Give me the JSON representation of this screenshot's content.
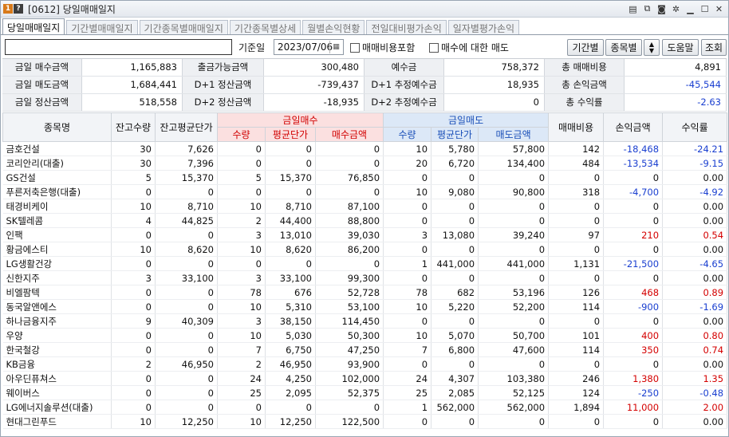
{
  "window": {
    "num_a": "1",
    "num_b": "?",
    "title": "[0612] 당일매매일지"
  },
  "tabs": [
    "당일매매일지",
    "기간별매매일지",
    "기간종목별매매일지",
    "기간종목별상세",
    "월별손익현황",
    "전일대비평가손익",
    "일자별평가손익"
  ],
  "toolbar": {
    "date_label": "기준일",
    "date": "2023/07/06",
    "include_fee": "매매비용포함",
    "sell_label": "매수에 대한 매도",
    "btn_period": "기간별",
    "btn_item": "종목별",
    "btn_help": "도움말",
    "btn_query": "조회"
  },
  "summary": [
    [
      [
        "금일 매수금액",
        "1,165,883"
      ],
      [
        "출금가능금액",
        "300,480"
      ],
      [
        "예수금",
        "758,372"
      ],
      [
        "총 매매비용",
        "4,891"
      ]
    ],
    [
      [
        "금일 매도금액",
        "1,684,441"
      ],
      [
        "D+1 정산금액",
        "-739,437"
      ],
      [
        "D+1 추정예수금",
        "18,935"
      ],
      [
        "총 손익금액",
        "-45,544"
      ]
    ],
    [
      [
        "금일 정산금액",
        "518,558"
      ],
      [
        "D+2 정산금액",
        "-18,935"
      ],
      [
        "D+2 추정예수금",
        "0"
      ],
      [
        "총 수익률",
        "-2.63"
      ]
    ]
  ],
  "header": {
    "name": "종목명",
    "hold_qty": "잔고수량",
    "hold_avg": "잔고평균단가",
    "buy_group": "금일매수",
    "sell_group": "금일매도",
    "qty": "수량",
    "avg": "평균단가",
    "buy_amt": "매수금액",
    "sell_amt": "매도금액",
    "fee": "매매비용",
    "pnl": "손익금액",
    "rate": "수익률"
  },
  "rows": [
    [
      "금호건설",
      "30",
      "7,626",
      "0",
      "0",
      "0",
      "10",
      "5,780",
      "57,800",
      "142",
      "-18,468",
      "-24.21"
    ],
    [
      "코리안리(대출)",
      "30",
      "7,396",
      "0",
      "0",
      "0",
      "20",
      "6,720",
      "134,400",
      "484",
      "-13,534",
      "-9.15"
    ],
    [
      "GS건설",
      "5",
      "15,370",
      "5",
      "15,370",
      "76,850",
      "0",
      "0",
      "0",
      "0",
      "0",
      "0.00"
    ],
    [
      "푸른저축은행(대출)",
      "0",
      "0",
      "0",
      "0",
      "0",
      "10",
      "9,080",
      "90,800",
      "318",
      "-4,700",
      "-4.92"
    ],
    [
      "태경비케이",
      "10",
      "8,710",
      "10",
      "8,710",
      "87,100",
      "0",
      "0",
      "0",
      "0",
      "0",
      "0.00"
    ],
    [
      "SK텔레콤",
      "4",
      "44,825",
      "2",
      "44,400",
      "88,800",
      "0",
      "0",
      "0",
      "0",
      "0",
      "0.00"
    ],
    [
      "인팩",
      "0",
      "0",
      "3",
      "13,010",
      "39,030",
      "3",
      "13,080",
      "39,240",
      "97",
      "210",
      "0.54"
    ],
    [
      "황금에스티",
      "10",
      "8,620",
      "10",
      "8,620",
      "86,200",
      "0",
      "0",
      "0",
      "0",
      "0",
      "0.00"
    ],
    [
      "LG생활건강",
      "0",
      "0",
      "0",
      "0",
      "0",
      "1",
      "441,000",
      "441,000",
      "1,131",
      "-21,500",
      "-4.65"
    ],
    [
      "신한지주",
      "3",
      "33,100",
      "3",
      "33,100",
      "99,300",
      "0",
      "0",
      "0",
      "0",
      "0",
      "0.00"
    ],
    [
      "비엘팜텍",
      "0",
      "0",
      "78",
      "676",
      "52,728",
      "78",
      "682",
      "53,196",
      "126",
      "468",
      "0.89"
    ],
    [
      "동국알앤에스",
      "0",
      "0",
      "10",
      "5,310",
      "53,100",
      "10",
      "5,220",
      "52,200",
      "114",
      "-900",
      "-1.69"
    ],
    [
      "하나금융지주",
      "9",
      "40,309",
      "3",
      "38,150",
      "114,450",
      "0",
      "0",
      "0",
      "0",
      "0",
      "0.00"
    ],
    [
      "우양",
      "0",
      "0",
      "10",
      "5,030",
      "50,300",
      "10",
      "5,070",
      "50,700",
      "101",
      "400",
      "0.80"
    ],
    [
      "한국철강",
      "0",
      "0",
      "7",
      "6,750",
      "47,250",
      "7",
      "6,800",
      "47,600",
      "114",
      "350",
      "0.74"
    ],
    [
      "KB금융",
      "2",
      "46,950",
      "2",
      "46,950",
      "93,900",
      "0",
      "0",
      "0",
      "0",
      "0",
      "0.00"
    ],
    [
      "아우딘퓨쳐스",
      "0",
      "0",
      "24",
      "4,250",
      "102,000",
      "24",
      "4,307",
      "103,380",
      "246",
      "1,380",
      "1.35"
    ],
    [
      "웨이버스",
      "0",
      "0",
      "25",
      "2,095",
      "52,375",
      "25",
      "2,085",
      "52,125",
      "124",
      "-250",
      "-0.48"
    ],
    [
      "LG에너지솔루션(대출)",
      "0",
      "0",
      "0",
      "0",
      "0",
      "1",
      "562,000",
      "562,000",
      "1,894",
      "11,000",
      "2.00"
    ],
    [
      "현대그린푸드",
      "10",
      "12,250",
      "10",
      "12,250",
      "122,500",
      "0",
      "0",
      "0",
      "0",
      "0",
      "0.00"
    ]
  ],
  "colors": {
    "positive": "#d40000",
    "negative": "#1a3fd0",
    "buy_header": "#fbe0e0",
    "sell_header": "#dce8f7"
  }
}
